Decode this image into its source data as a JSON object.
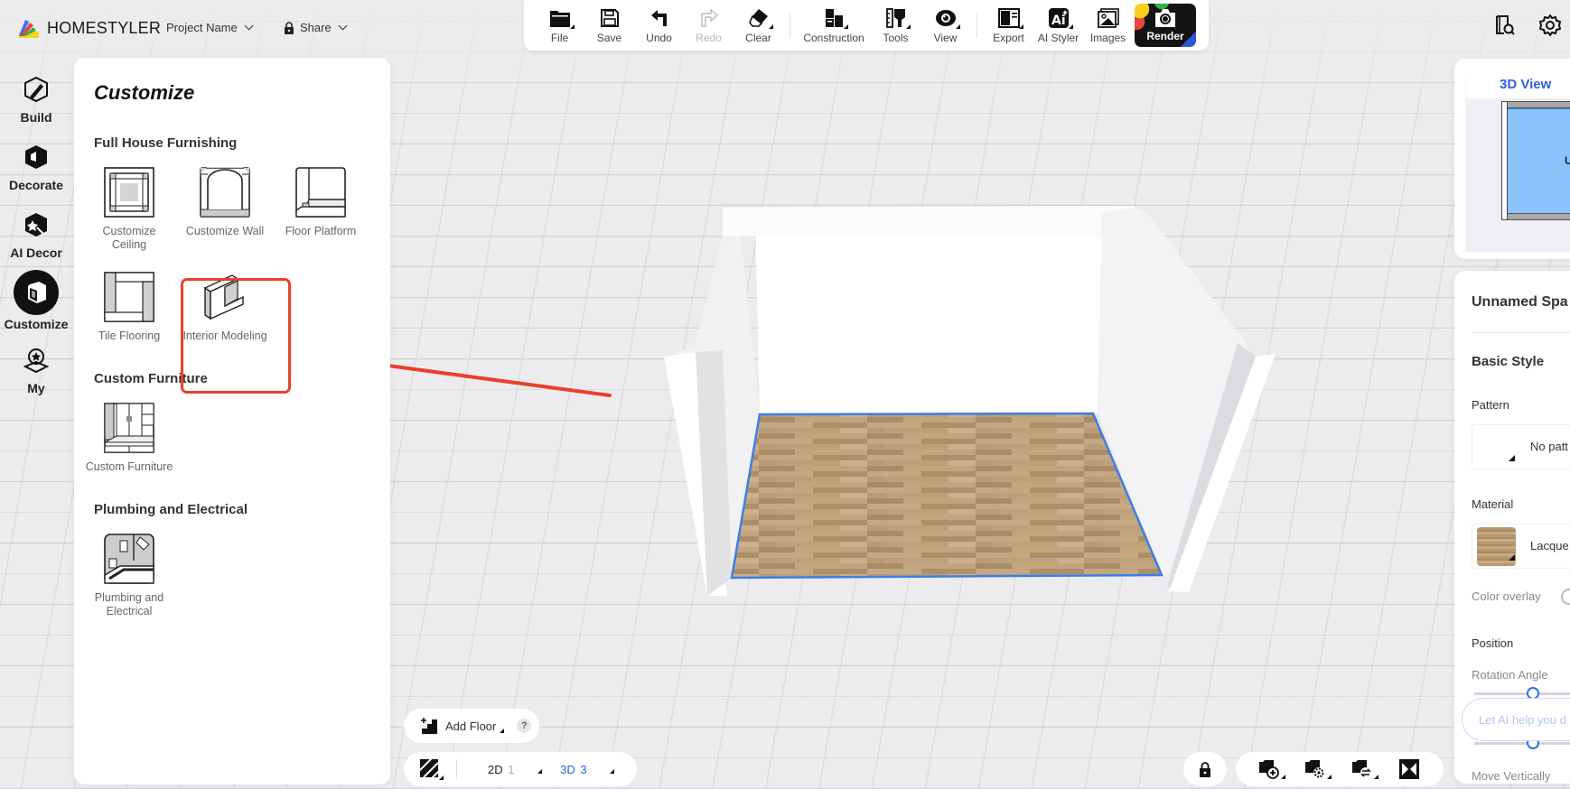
{
  "app": {
    "brand": "HOMESTYLER",
    "project_menu": "Project Name",
    "share_menu": "Share"
  },
  "toolbar": {
    "items": [
      {
        "label": "File",
        "icon": "folder-icon",
        "has_menu": true,
        "disabled": false
      },
      {
        "label": "Save",
        "icon": "floppy-disk-icon",
        "has_menu": false,
        "disabled": false
      },
      {
        "label": "Undo",
        "icon": "undo-arrow-icon",
        "has_menu": false,
        "disabled": false
      },
      {
        "label": "Redo",
        "icon": "redo-arrow-icon",
        "has_menu": false,
        "disabled": true
      },
      {
        "label": "Clear",
        "icon": "eraser-icon",
        "has_menu": true,
        "disabled": false
      },
      {
        "label": "Construction",
        "icon": "construction-blocks-icon",
        "has_menu": true,
        "disabled": false
      },
      {
        "label": "Tools",
        "icon": "ruler-brush-icon",
        "has_menu": true,
        "disabled": false
      },
      {
        "label": "View",
        "icon": "eye-icon",
        "has_menu": true,
        "disabled": false
      },
      {
        "label": "Export",
        "icon": "export-layout-icon",
        "has_menu": true,
        "disabled": false
      },
      {
        "label": "AI Styler",
        "icon": "ai-sparkle-icon",
        "has_menu": true,
        "disabled": false
      },
      {
        "label": "Images",
        "icon": "image-gallery-icon",
        "has_menu": false,
        "disabled": false
      }
    ],
    "render_label": "Render"
  },
  "rail": {
    "items": [
      {
        "label": "Build",
        "icon": "build-pencil-icon",
        "active": false
      },
      {
        "label": "Decorate",
        "icon": "armchair-icon",
        "active": false
      },
      {
        "label": "AI Decor",
        "icon": "ai-magic-wand-icon",
        "active": false
      },
      {
        "label": "Customize",
        "icon": "cabinet-icon",
        "active": true
      },
      {
        "label": "My",
        "icon": "star-badge-icon",
        "active": false
      }
    ]
  },
  "customize": {
    "title": "Customize",
    "sections": [
      {
        "title": "Full House Furnishing",
        "items": [
          {
            "label": "Customize Ceiling",
            "icon": "ceiling-icon"
          },
          {
            "label": "Customize Wall",
            "icon": "wall-arch-icon"
          },
          {
            "label": "Floor Platform",
            "icon": "floor-platform-icon"
          },
          {
            "label": "Tile Flooring",
            "icon": "tile-flooring-icon"
          },
          {
            "label": "Interior Modeling",
            "icon": "interior-modeling-icon",
            "highlighted": true
          }
        ]
      },
      {
        "title": "Custom Furniture",
        "items": [
          {
            "label": "Custom Furniture",
            "icon": "wardrobe-icon"
          }
        ]
      },
      {
        "title": "Plumbing and Electrical",
        "items": [
          {
            "label": "Plumbing and Electrical",
            "icon": "plumbing-electrical-icon"
          }
        ]
      }
    ]
  },
  "annotation": {
    "color": "#e8412c",
    "target": "Interior Modeling"
  },
  "view_card": {
    "tab_label": "3D View",
    "room_label": "Un"
  },
  "properties": {
    "title": "Unnamed Spa",
    "basic_style": "Basic Style",
    "pattern_label": "Pattern",
    "pattern_value": "No patt",
    "material_label": "Material",
    "material_value": "Lacque",
    "color_overlay_label": "Color overlay",
    "color_overlay_on": false,
    "position_label": "Position",
    "rotation_label": "Rotation Angle",
    "rotation_slider_fraction": 0.5,
    "move_vertical_label": "Move Vertically",
    "second_slider_fraction": 0.5,
    "ai_placeholder": "Let AI help you d"
  },
  "bottom": {
    "add_floor_label": "Add Floor",
    "help_label": "?",
    "view_2d_label": "2D",
    "view_2d_count": "1",
    "view_3d_label": "3D",
    "view_3d_count": "3"
  },
  "colors": {
    "accent": "#2f5fe3",
    "selection": "#3c7ee8",
    "annotation": "#e8412c"
  }
}
